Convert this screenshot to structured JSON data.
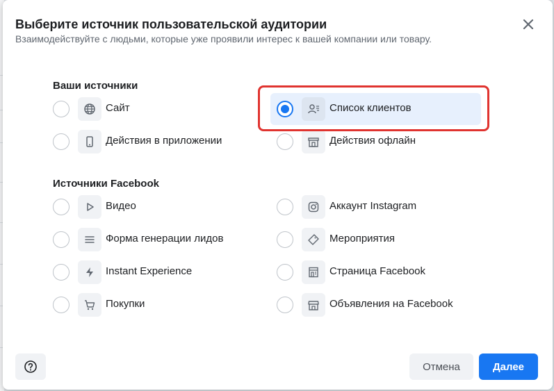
{
  "dialog": {
    "title": "Выберите источник пользовательской аудитории",
    "subtitle": "Взаимодействуйте с людьми, которые уже проявили интерес к вашей компании или товару."
  },
  "sections": {
    "your_sources": "Ваши источники",
    "facebook_sources": "Источники Facebook"
  },
  "options": {
    "site": {
      "label": "Сайт",
      "icon": "globe-icon",
      "selected": false
    },
    "customer_list": {
      "label": "Список клиентов",
      "icon": "customer-list-icon",
      "selected": true
    },
    "app_activity": {
      "label": "Действия в приложении",
      "icon": "mobile-icon",
      "selected": false
    },
    "offline_activity": {
      "label": "Действия офлайн",
      "icon": "store-icon",
      "selected": false
    },
    "video": {
      "label": "Видео",
      "icon": "play-icon",
      "selected": false
    },
    "instagram": {
      "label": "Аккаунт Instagram",
      "icon": "instagram-icon",
      "selected": false
    },
    "lead_form": {
      "label": "Форма генерации лидов",
      "icon": "lines-icon",
      "selected": false
    },
    "events": {
      "label": "Мероприятия",
      "icon": "ticket-icon",
      "selected": false
    },
    "instant_experience": {
      "label": "Instant Experience",
      "icon": "lightning-icon",
      "selected": false
    },
    "fb_page": {
      "label": "Страница Facebook",
      "icon": "page-icon",
      "selected": false
    },
    "shopping": {
      "label": "Покупки",
      "icon": "cart-icon",
      "selected": false
    },
    "fb_listings": {
      "label": "Объявления на Facebook",
      "icon": "marketplace-icon",
      "selected": false
    }
  },
  "footer": {
    "help_icon": "question-icon",
    "cancel_label": "Отмена",
    "next_label": "Далее"
  },
  "colors": {
    "accent": "#1877f2",
    "highlight_border": "#e0332f",
    "selected_bg": "#e7f0fd"
  }
}
